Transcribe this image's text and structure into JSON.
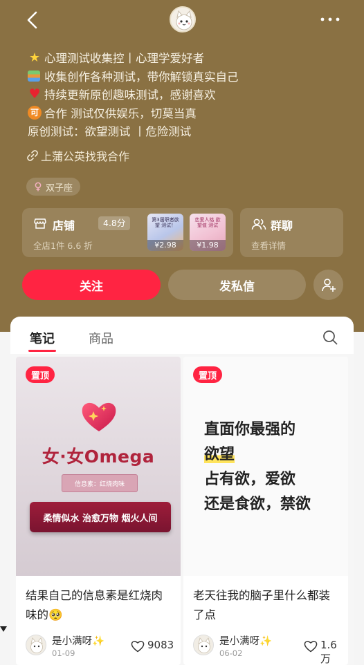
{
  "header": {
    "back_icon": "chevron-left-icon",
    "more_icon": "more-horizontal-icon"
  },
  "profile": {
    "bio": [
      {
        "emoji": "star-icon",
        "text": "心理测试收集控丨心理学爱好者"
      },
      {
        "emoji": "books-icon",
        "text": "收集创作各种测试，带你解锁真实自己"
      },
      {
        "emoji": "heart-icon",
        "text": "持续更新原创趣味测试，感谢喜欢"
      },
      {
        "emoji": "ke-icon",
        "emoji_text": "可",
        "text": "合作  测试仅供娱乐，切莫当真"
      },
      {
        "emoji": "",
        "text": "原创测试：欲望测试 丨危险测试"
      }
    ],
    "link_text": "上蒲公英找我合作",
    "zodiac": "双子座"
  },
  "store": {
    "title": "店铺",
    "rating": "4.8分",
    "subtitle": "全店1件 6.6 折",
    "products": [
      {
        "cover_text": "第3届职者欲望 测试！",
        "price": "¥2.98"
      },
      {
        "cover_text": "恋爱人格 欲望值 测试",
        "price": "¥1.98"
      }
    ]
  },
  "group_chat": {
    "title": "群聊",
    "subtitle": "查看详情"
  },
  "actions": {
    "follow": "关注",
    "message": "发私信"
  },
  "tabs": [
    {
      "label": "笔记",
      "active": true
    },
    {
      "label": "商品",
      "active": false
    }
  ],
  "notes": [
    {
      "pinned_label": "置顶",
      "cover": {
        "title": "女·女Omega",
        "chip": "信息素：红烧肉味",
        "banner": "柔情似水 治愈万物 烟火人间"
      },
      "title": "结果自己的信息素是红烧肉味的🥺",
      "author": "是小满呀✨",
      "date": "01-09",
      "likes": "9083"
    },
    {
      "pinned_label": "置顶",
      "cover": {
        "lines": [
          "直面你最强的",
          "欲望",
          "占有欲，爱欲",
          "还是食欲，禁欲"
        ]
      },
      "title": "老天往我的脑子里什么都装了点",
      "author": "是小满呀✨",
      "date": "06-02",
      "likes": "1.6万"
    }
  ],
  "colors": {
    "profile_bg": "#8a7143",
    "accent": "#ff2442",
    "highlight": "#ffe45c"
  }
}
